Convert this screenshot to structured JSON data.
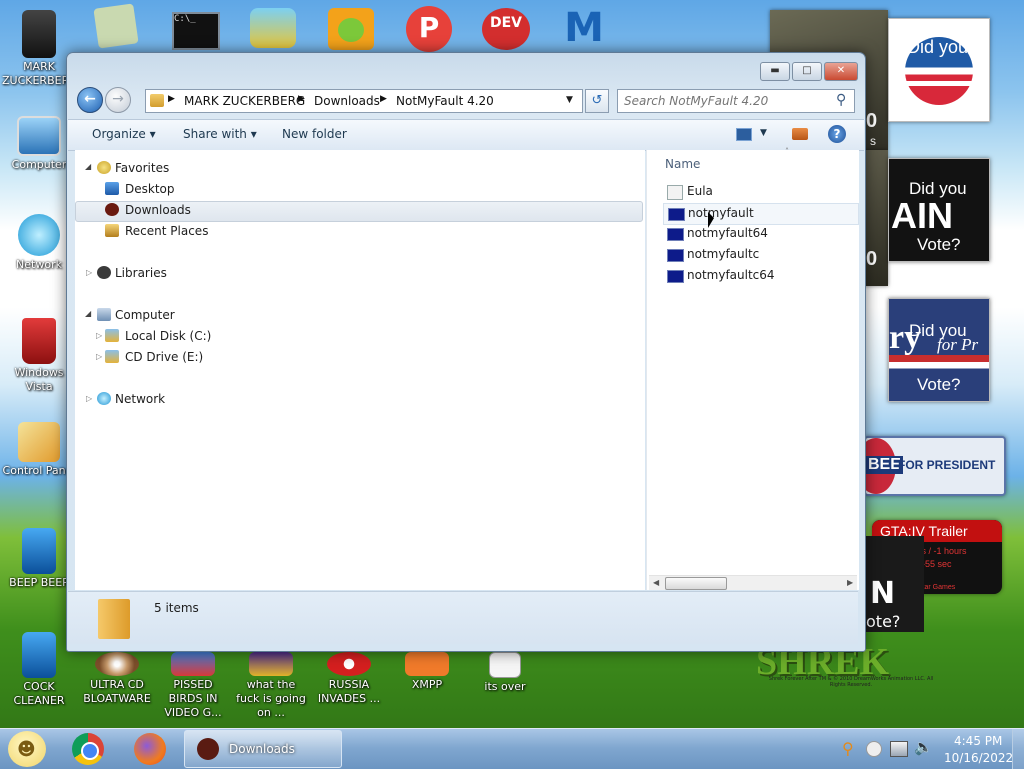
{
  "desktop_icons": [
    {
      "label": "MARK ZUCKERBERG",
      "icon": "user-folder-icon"
    },
    {
      "label": "Computer",
      "icon": "computer-icon"
    },
    {
      "label": "Network",
      "icon": "network-icon"
    },
    {
      "label": "Windows Vista",
      "icon": "recycle-bin-icon"
    },
    {
      "label": "Control Panel",
      "icon": "control-panel-icon"
    },
    {
      "label": "BEEP BEEP",
      "icon": "blue-box-icon"
    },
    {
      "label": "COCK CLEANER",
      "icon": "blue-box-icon"
    },
    {
      "label": "ULTRA CD BLOATWARE",
      "icon": "cd-icon"
    },
    {
      "label": "PISSED BIRDS IN VIDEO G...",
      "icon": "angry-birds-icon"
    },
    {
      "label": "what the fuck is going on ...",
      "icon": "game-icon"
    },
    {
      "label": "RUSSIA INVADES ...",
      "icon": "radiation-icon"
    },
    {
      "label": "XMPP",
      "icon": "xampp-icon"
    },
    {
      "label": "its over",
      "icon": "document-icon"
    }
  ],
  "gadgets": {
    "obama": {
      "text": "Did you"
    },
    "mccain": {
      "text1": "Did you",
      "text2": "AIN",
      "text3": "Vote?"
    },
    "kerry": {
      "text1": "Did you",
      "text2": "ry",
      "text3": "for Pr",
      "text4": "Vote?"
    },
    "huckabee": {
      "text1": "BEE",
      "text2": "FOR PRESIDENT"
    },
    "gta": {
      "title": "GTA:IV Trailer",
      "line1": "-5681 Days / -1 hours",
      "line2": "-48 mins / -55 sec",
      "footer": "© Rockstar Games"
    },
    "shrek": {
      "text": "SHREK",
      "small": "Shrek Forever After TM & © 2010 DreamWorks Animation LLC. All Rights Reserved.",
      "partial1": "0",
      "partial2": "s",
      "partial3": "0",
      "partial4": "N",
      "partial5": "ote?"
    }
  },
  "window": {
    "address": {
      "crumbs": [
        "MARK ZUCKERBERG",
        "Downloads",
        "NotMyFault 4.20"
      ]
    },
    "search": {
      "placeholder": "Search NotMyFault 4.20"
    },
    "toolbar": {
      "organize": "Organize",
      "share_with": "Share with",
      "new_folder": "New folder"
    },
    "nav": {
      "favorites": "Favorites",
      "desktop": "Desktop",
      "downloads": "Downloads",
      "recent_places": "Recent Places",
      "libraries": "Libraries",
      "computer": "Computer",
      "local_disk": "Local Disk (C:)",
      "cd_drive": "CD Drive (E:)",
      "network": "Network"
    },
    "content": {
      "column_name": "Name",
      "files": [
        "Eula",
        "notmyfault",
        "notmyfault64",
        "notmyfaultc",
        "notmyfaultc64"
      ]
    },
    "details": {
      "count": "5 items"
    }
  },
  "taskbar": {
    "active_window": "Downloads",
    "time": "4:45 PM",
    "date": "10/16/2022"
  }
}
